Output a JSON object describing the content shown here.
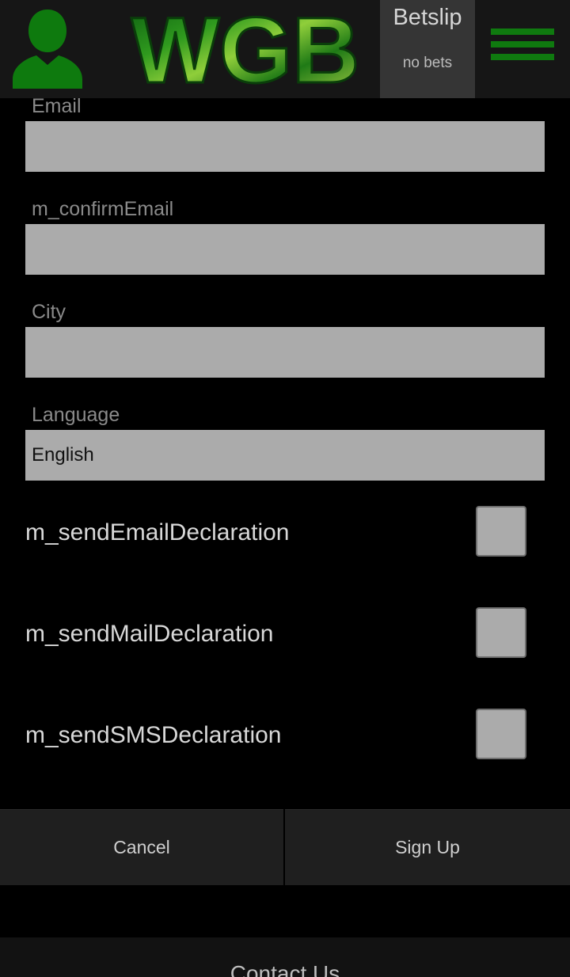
{
  "header": {
    "logo_text": "WGB",
    "betslip_title": "Betslip",
    "betslip_status": "no bets",
    "accent_green": "#0f7a0f",
    "icons": [
      "user-icon",
      "hamburger-menu-icon"
    ]
  },
  "form": {
    "email": {
      "label": "Email",
      "value": ""
    },
    "confirm_email": {
      "label": "m_confirmEmail",
      "value": ""
    },
    "city": {
      "label": "City",
      "value": ""
    },
    "language": {
      "label": "Language",
      "value": "English"
    },
    "checks": [
      {
        "label": "m_sendEmailDeclaration",
        "checked": false
      },
      {
        "label": "m_sendMailDeclaration",
        "checked": false
      },
      {
        "label": "m_sendSMSDeclaration",
        "checked": false
      }
    ]
  },
  "actions": {
    "cancel_label": "Cancel",
    "signup_label": "Sign Up"
  },
  "footer": {
    "title": "Contact Us"
  }
}
